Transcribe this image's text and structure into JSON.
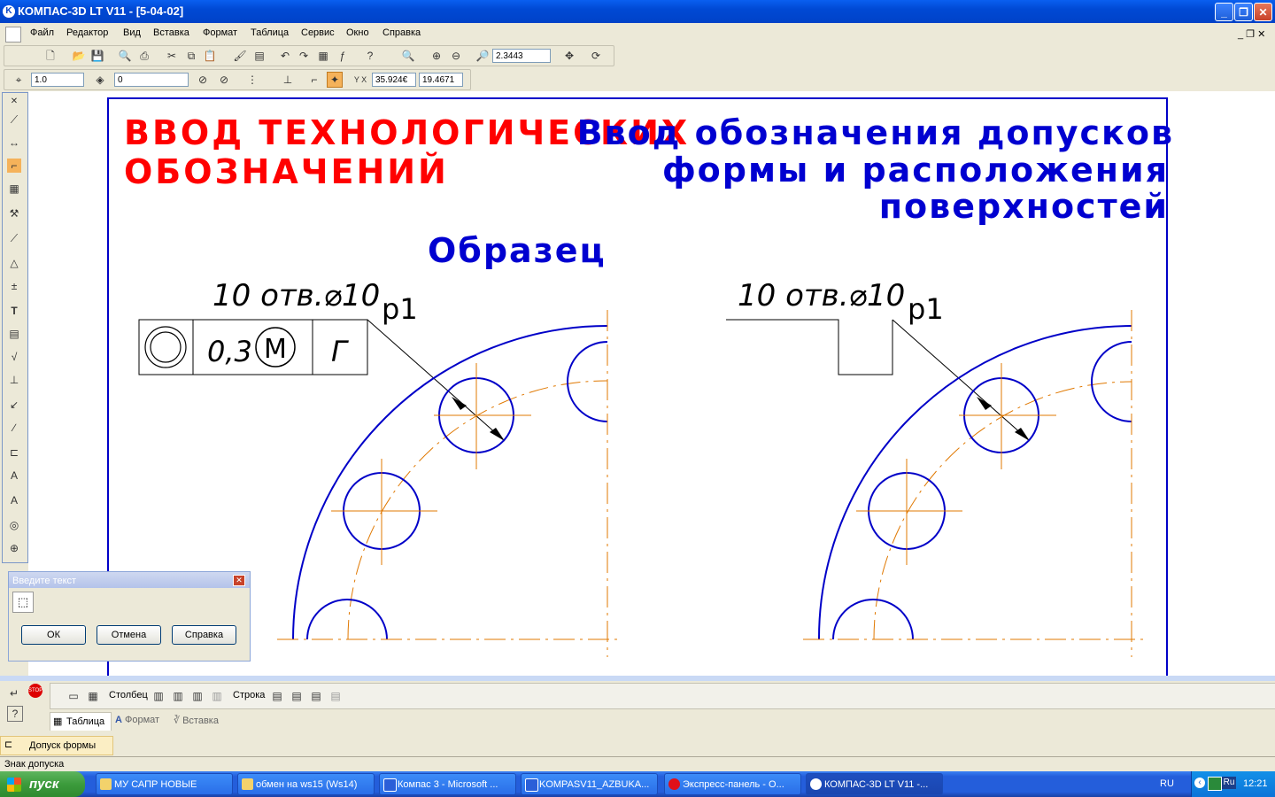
{
  "window": {
    "title": "КОМПАС-3D LT V11 - [5-04-02]",
    "app_icon": "kompas-icon"
  },
  "menu": [
    "Файл",
    "Редактор",
    "Вид",
    "Вставка",
    "Формат",
    "Таблица",
    "Сервис",
    "Окно",
    "Справка"
  ],
  "toolbar": {
    "zoom_value": "2.3443",
    "line_scale": "1.0",
    "layer": "0",
    "coord_x": "35.924€",
    "coord_y": "19.4671"
  },
  "drawing": {
    "title_left_line1": "ВВОД ТЕХНОЛОГИЧЕСКИХ",
    "title_left_line2": "ОБОЗНАЧЕНИЙ",
    "title_right_line1": "Ввод обозначения допусков",
    "title_right_line2": "формы и расположения",
    "title_right_line3": "поверхностей",
    "sample_label": "Образец",
    "hole_note": "10 отв.⌀10",
    "leader_label": "р1",
    "tolerance_value": "0,3",
    "tolerance_modifier": "M",
    "tolerance_base": "Г",
    "colors": {
      "left_title": "#ff0000",
      "right_title": "#0000d0",
      "contour": "#0000c8",
      "axis": "#e07800"
    }
  },
  "dialog": {
    "title": "Введите текст",
    "ok": "ОК",
    "cancel": "Отмена",
    "help": "Справка"
  },
  "bottom_panel": {
    "column_label": "Столбец",
    "row_label": "Строка",
    "tabs": [
      "Таблица",
      "Формат",
      "Вставка"
    ],
    "active_item": "Допуск формы"
  },
  "status": {
    "text": "Знак допуска"
  },
  "taskbar": {
    "start": "пуск",
    "items": [
      "МУ САПР НОВЫЕ",
      "обмен на ws15 (Ws14)",
      "Компас 3 - Microsoft ...",
      "KOMPASV11_AZBUKA...",
      "Экспресс-панель - O...",
      "КОМПАС-3D LT V11 -..."
    ],
    "lang": "RU",
    "lang2": "Ru",
    "clock": "12:21"
  }
}
